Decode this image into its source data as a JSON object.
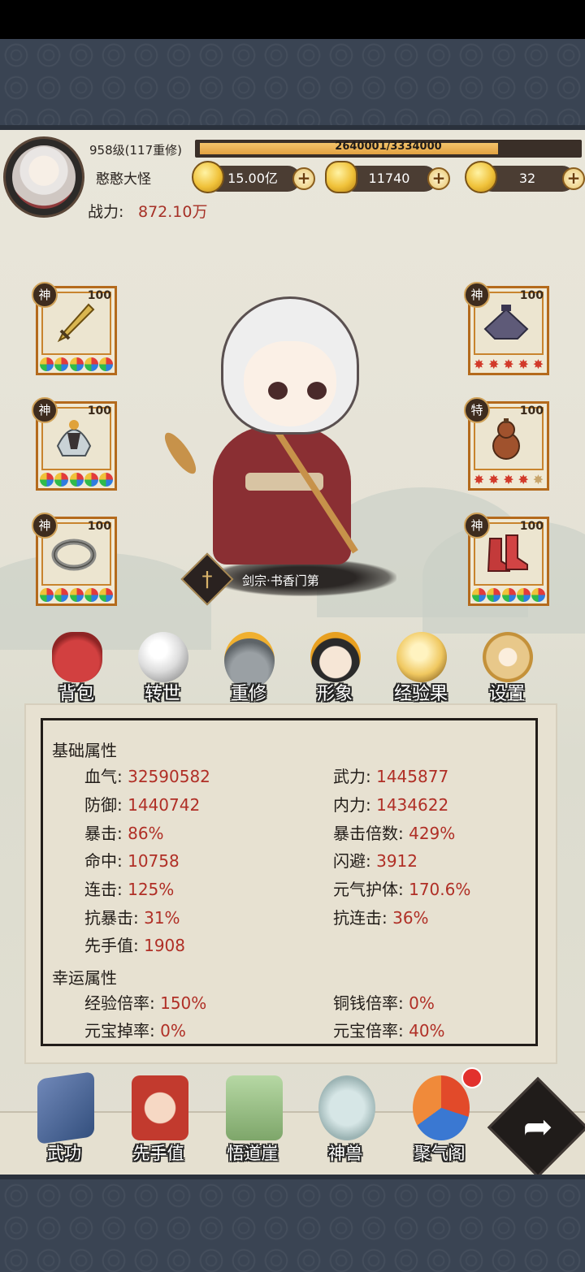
{
  "player": {
    "level": "958级(117重修)",
    "name": "憨憨大怪",
    "power_label": "战力:",
    "power_value": "872.10万",
    "exp_text": "2640001/3334000",
    "exp_progress": 0.792
  },
  "resources": [
    {
      "icon": "copper-coin-icon",
      "value": "15.00亿"
    },
    {
      "icon": "gold-ingot-icon",
      "value": "11740"
    },
    {
      "icon": "gold-gourd-icon",
      "value": "32"
    }
  ],
  "plus_glyph": "+",
  "equipment": {
    "left": [
      {
        "icon": "sword-icon",
        "grade": "神",
        "level": "100"
      },
      {
        "icon": "helmet-icon",
        "grade": "神",
        "level": "100"
      },
      {
        "icon": "ring-icon",
        "grade": "神",
        "level": "100"
      }
    ],
    "right": [
      {
        "icon": "hat-icon",
        "grade": "神",
        "level": "100"
      },
      {
        "icon": "gourd-icon",
        "grade": "特",
        "level": "100"
      },
      {
        "icon": "boots-icon",
        "grade": "神",
        "level": "100"
      }
    ]
  },
  "sect": "剑宗·书香门第",
  "actions": [
    {
      "id": "bag",
      "label": "背包",
      "icon": "bag-icon"
    },
    {
      "id": "rebirth",
      "label": "转世",
      "icon": "orb-icon"
    },
    {
      "id": "recultivate",
      "label": "重修",
      "icon": "cauldron-icon"
    },
    {
      "id": "appearance",
      "label": "形象",
      "icon": "face-icon"
    },
    {
      "id": "exp-fruit",
      "label": "经验果",
      "icon": "fruit-icon"
    },
    {
      "id": "settings",
      "label": "设置",
      "icon": "gear-icon"
    }
  ],
  "stats": {
    "base_title": "基础属性",
    "base": [
      {
        "label": "血气:",
        "value": "32590582"
      },
      {
        "label": "武力:",
        "value": "1445877"
      },
      {
        "label": "防御:",
        "value": "1440742"
      },
      {
        "label": "内力:",
        "value": "1434622"
      },
      {
        "label": "暴击:",
        "value": "86%"
      },
      {
        "label": "暴击倍数:",
        "value": "429%"
      },
      {
        "label": "命中:",
        "value": "10758"
      },
      {
        "label": "闪避:",
        "value": "3912"
      },
      {
        "label": "连击:",
        "value": "125%"
      },
      {
        "label": "元气护体:",
        "value": "170.6%"
      },
      {
        "label": "抗暴击:",
        "value": "31%"
      },
      {
        "label": "抗连击:",
        "value": "36%"
      },
      {
        "label": "先手值:",
        "value": "1908"
      }
    ],
    "luck_title": "幸运属性",
    "luck": [
      {
        "label": "经验倍率:",
        "value": "150%"
      },
      {
        "label": "铜钱倍率:",
        "value": "0%"
      },
      {
        "label": "元宝掉率:",
        "value": "0%"
      },
      {
        "label": "元宝倍率:",
        "value": "40%"
      }
    ]
  },
  "nav": [
    {
      "id": "martial-arts",
      "label": "武功",
      "icon": "book-icon"
    },
    {
      "id": "initiative",
      "label": "先手值",
      "icon": "hand-icon"
    },
    {
      "id": "cliff",
      "label": "悟道崖",
      "icon": "cliff-icon"
    },
    {
      "id": "beast",
      "label": "神兽",
      "icon": "lion-icon"
    },
    {
      "id": "qi-pavilion",
      "label": "聚气阁",
      "icon": "flame-icon"
    }
  ],
  "arrow_glyph": "➦",
  "colors": {
    "accent_red": "#b02f26",
    "frame_orange": "#b46a1c",
    "dark": "#221d19"
  }
}
